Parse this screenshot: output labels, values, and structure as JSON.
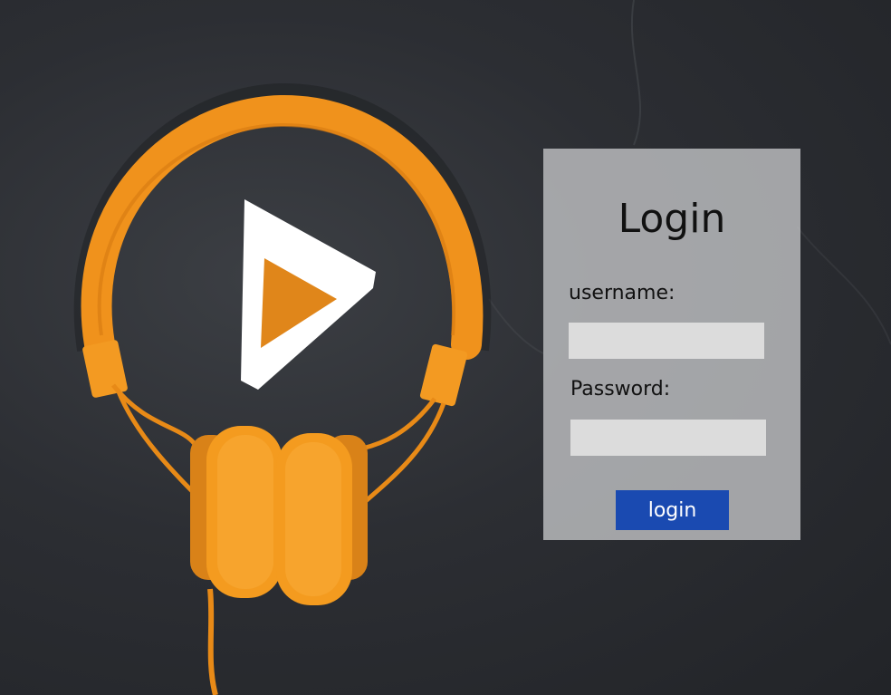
{
  "login": {
    "title": "Login",
    "username_label": "username:",
    "username_value": "",
    "password_label": "Password:",
    "password_value": "",
    "button_label": "login"
  },
  "colors": {
    "background": "#2c2e33",
    "headphones": "#f0921c",
    "panel": "#bebfc2",
    "field": "#dcdcdc",
    "button": "#1a4ab1",
    "button_text": "#ffffff"
  },
  "icons": {
    "hero": "headphones-icon",
    "play": "play-icon"
  }
}
